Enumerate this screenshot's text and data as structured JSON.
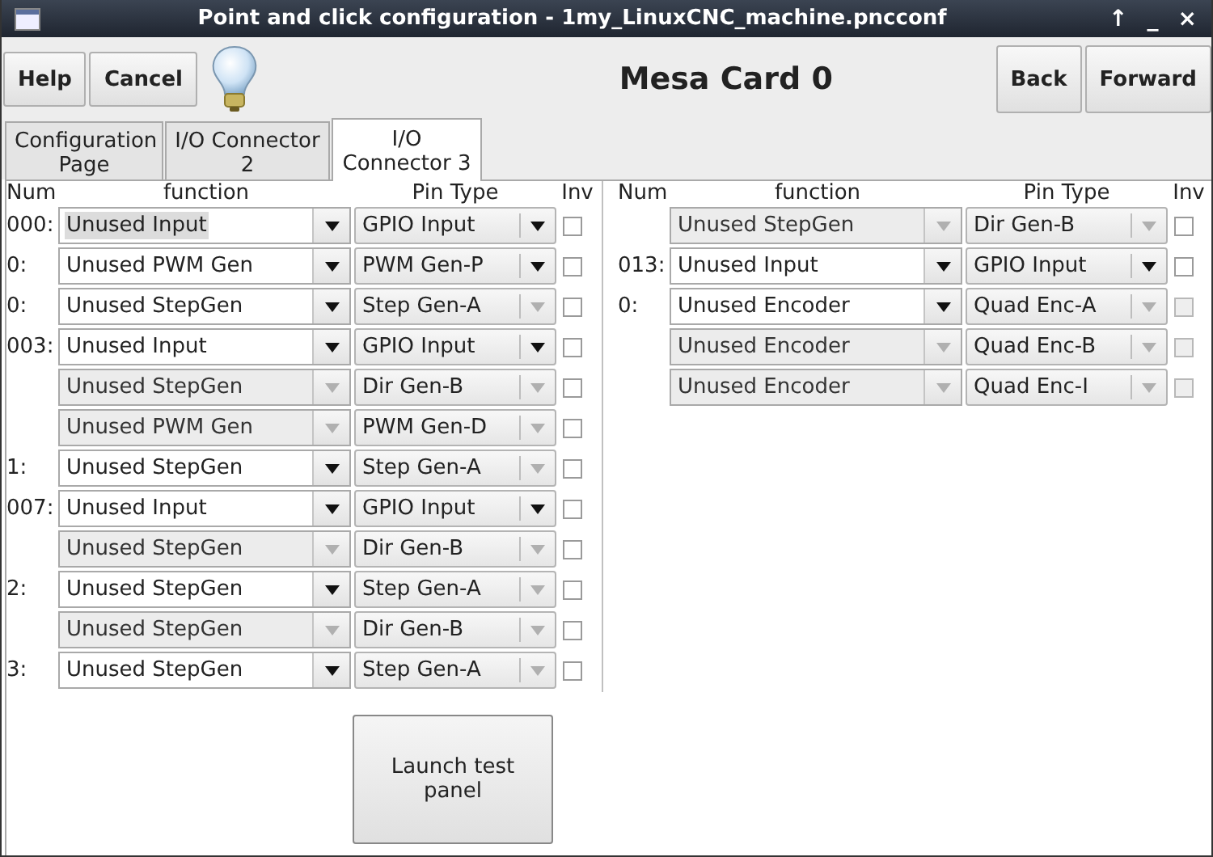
{
  "window": {
    "title": "Point and click configuration - 1my_LinuxCNC_machine.pncconf",
    "controls": [
      "↑",
      "_",
      "×"
    ]
  },
  "toolbar": {
    "left_buttons": [
      "Help",
      "Cancel"
    ],
    "heading": "Mesa Card 0",
    "right_buttons": [
      "Back",
      "Forward"
    ]
  },
  "tabs": [
    {
      "label": "Configuration Page",
      "selected": false
    },
    {
      "label": "I/O Connector 2",
      "selected": false
    },
    {
      "label": "I/O Connector 3",
      "selected": true
    }
  ],
  "tables": [
    {
      "columns": [
        "Num",
        "function",
        "Pin Type",
        "Inv"
      ],
      "rows": [
        {
          "num": "000:",
          "function": "Unused Input",
          "pin_type": "GPIO Input",
          "function_disabled": false,
          "pin_type_disabled": false,
          "inv_disabled": false,
          "checked": false,
          "highlighted": true
        },
        {
          "num": "0:",
          "function": "Unused PWM Gen",
          "pin_type": "PWM Gen-P",
          "function_disabled": false,
          "pin_type_disabled": false,
          "inv_disabled": false,
          "checked": false,
          "highlighted": false
        },
        {
          "num": "0:",
          "function": "Unused StepGen",
          "pin_type": "Step Gen-A",
          "function_disabled": false,
          "pin_type_disabled": true,
          "inv_disabled": false,
          "checked": false,
          "highlighted": false
        },
        {
          "num": "003:",
          "function": "Unused Input",
          "pin_type": "GPIO Input",
          "function_disabled": false,
          "pin_type_disabled": false,
          "inv_disabled": false,
          "checked": false,
          "highlighted": false
        },
        {
          "num": "",
          "function": "Unused StepGen",
          "pin_type": "Dir Gen-B",
          "function_disabled": true,
          "pin_type_disabled": true,
          "inv_disabled": false,
          "checked": false,
          "highlighted": false
        },
        {
          "num": "",
          "function": "Unused PWM Gen",
          "pin_type": "PWM Gen-D",
          "function_disabled": true,
          "pin_type_disabled": true,
          "inv_disabled": false,
          "checked": false,
          "highlighted": false
        },
        {
          "num": "1:",
          "function": "Unused StepGen",
          "pin_type": "Step Gen-A",
          "function_disabled": false,
          "pin_type_disabled": true,
          "inv_disabled": false,
          "checked": false,
          "highlighted": false
        },
        {
          "num": "007:",
          "function": "Unused Input",
          "pin_type": "GPIO Input",
          "function_disabled": false,
          "pin_type_disabled": false,
          "inv_disabled": false,
          "checked": false,
          "highlighted": false
        },
        {
          "num": "",
          "function": "Unused StepGen",
          "pin_type": "Dir Gen-B",
          "function_disabled": true,
          "pin_type_disabled": true,
          "inv_disabled": false,
          "checked": false,
          "highlighted": false
        },
        {
          "num": "2:",
          "function": "Unused StepGen",
          "pin_type": "Step Gen-A",
          "function_disabled": false,
          "pin_type_disabled": true,
          "inv_disabled": false,
          "checked": false,
          "highlighted": false
        },
        {
          "num": "",
          "function": "Unused StepGen",
          "pin_type": "Dir Gen-B",
          "function_disabled": true,
          "pin_type_disabled": true,
          "inv_disabled": false,
          "checked": false,
          "highlighted": false
        },
        {
          "num": "3:",
          "function": "Unused StepGen",
          "pin_type": "Step Gen-A",
          "function_disabled": false,
          "pin_type_disabled": true,
          "inv_disabled": false,
          "checked": false,
          "highlighted": false
        }
      ]
    },
    {
      "columns": [
        "Num",
        "function",
        "Pin Type",
        "Inv"
      ],
      "rows": [
        {
          "num": "",
          "function": "Unused StepGen",
          "pin_type": "Dir Gen-B",
          "function_disabled": true,
          "pin_type_disabled": true,
          "inv_disabled": false,
          "checked": false,
          "highlighted": false
        },
        {
          "num": "013:",
          "function": "Unused Input",
          "pin_type": "GPIO Input",
          "function_disabled": false,
          "pin_type_disabled": false,
          "inv_disabled": false,
          "checked": false,
          "highlighted": false
        },
        {
          "num": "0:",
          "function": "Unused Encoder",
          "pin_type": "Quad Enc-A",
          "function_disabled": false,
          "pin_type_disabled": true,
          "inv_disabled": true,
          "checked": false,
          "highlighted": false
        },
        {
          "num": "",
          "function": "Unused Encoder",
          "pin_type": "Quad Enc-B",
          "function_disabled": true,
          "pin_type_disabled": true,
          "inv_disabled": true,
          "checked": false,
          "highlighted": false
        },
        {
          "num": "",
          "function": "Unused Encoder",
          "pin_type": "Quad Enc-I",
          "function_disabled": true,
          "pin_type_disabled": true,
          "inv_disabled": true,
          "checked": false,
          "highlighted": false
        }
      ]
    }
  ],
  "launch_button": "Launch test panel"
}
